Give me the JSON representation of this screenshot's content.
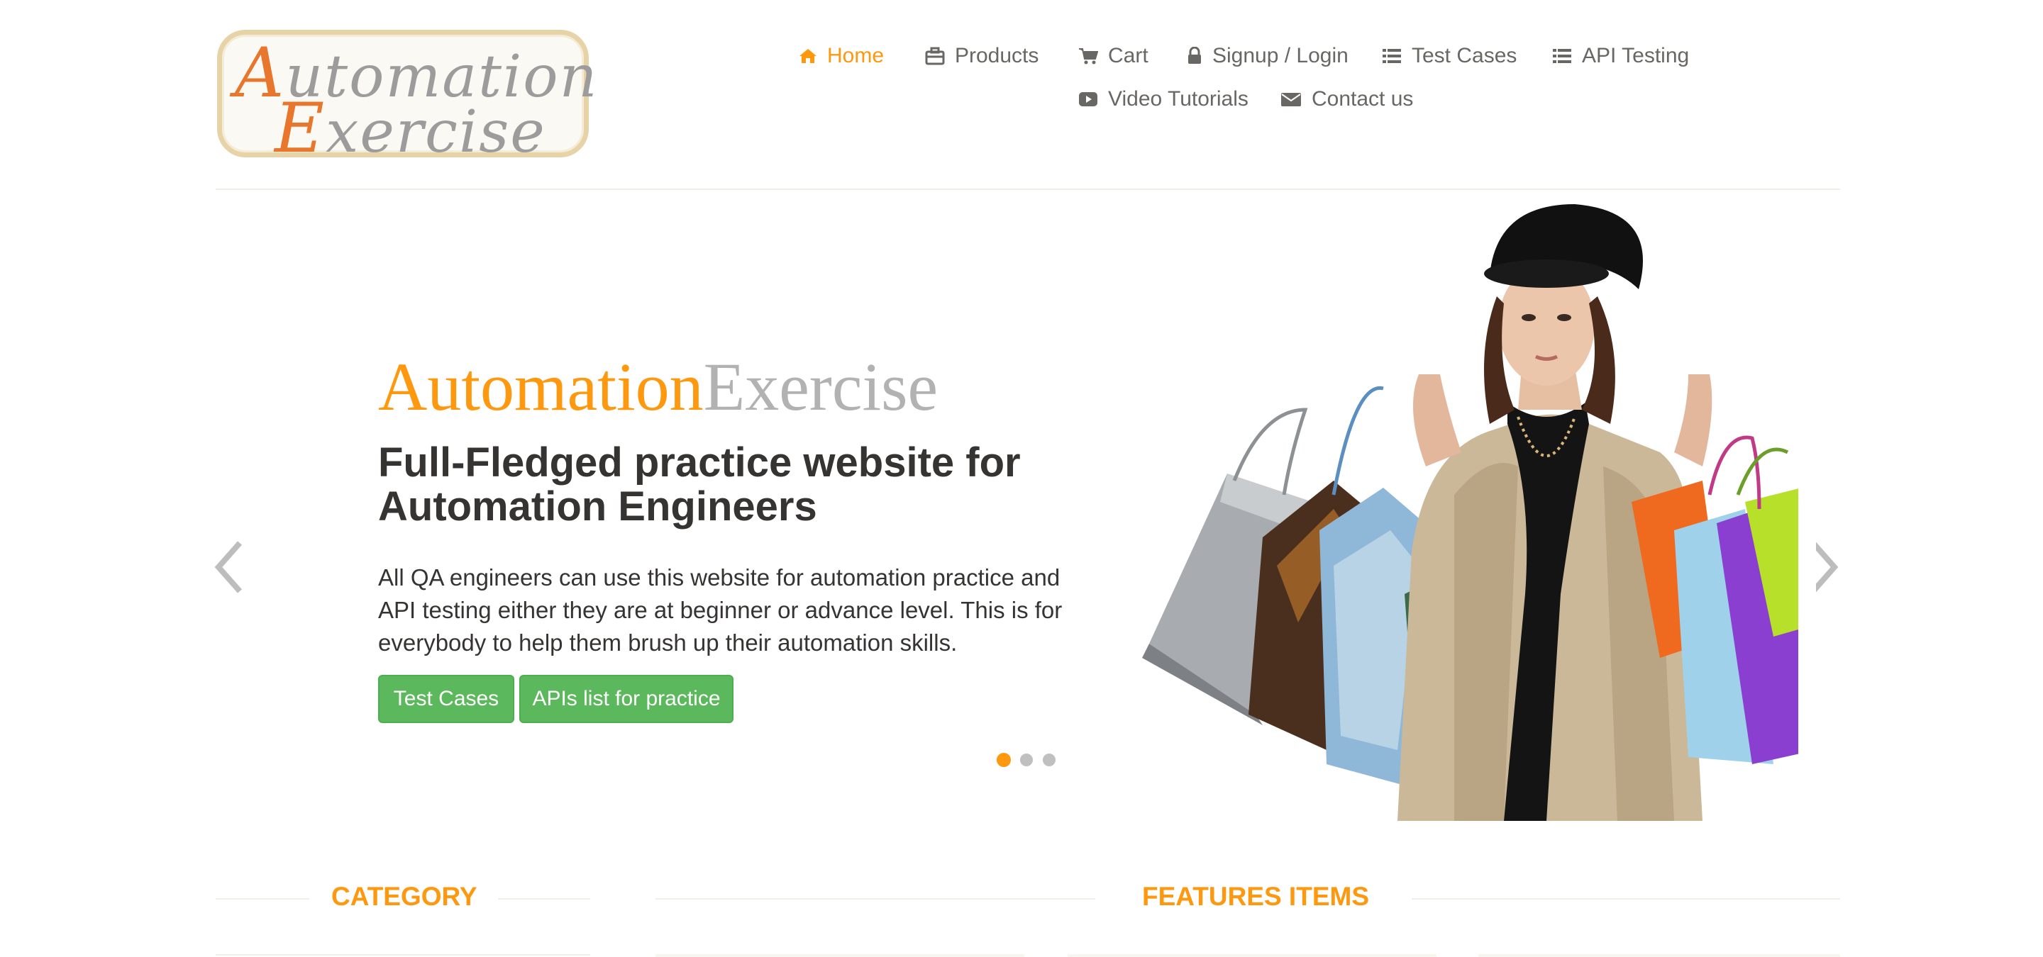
{
  "logo": {
    "line1_cap": "A",
    "line1_rest": "utomation",
    "line2_cap": "E",
    "line2_rest": "xercise"
  },
  "nav": {
    "items": [
      {
        "label": "Home",
        "icon": "home-icon",
        "active": true
      },
      {
        "label": "Products",
        "icon": "briefcase-icon"
      },
      {
        "label": "Cart",
        "icon": "cart-icon"
      },
      {
        "label": "Signup / Login",
        "icon": "lock-icon"
      },
      {
        "label": "Test Cases",
        "icon": "list-icon"
      },
      {
        "label": "API Testing",
        "icon": "list-icon"
      },
      {
        "label": "Video Tutorials",
        "icon": "youtube-icon"
      },
      {
        "label": "Contact us",
        "icon": "envelope-icon"
      }
    ]
  },
  "slider": {
    "brand_part1": "Automation",
    "brand_part2": "Exercise",
    "headline": "Full-Fledged practice website for Automation Engineers",
    "description": "All QA engineers can use this website for automation practice and API testing either they are at beginner or advance level. This is for everybody to help them brush up their automation skills.",
    "buttons": {
      "test_cases": "Test Cases",
      "apis_list": "APIs list for practice"
    },
    "indicators": {
      "count": 3,
      "active_index": 0
    }
  },
  "sections": {
    "category_title": "CATEGORY",
    "features_title": "FEATURES ITEMS"
  },
  "colors": {
    "accent": "#fe980f",
    "button": "#5cb85c",
    "text": "#696763",
    "heading": "#363432"
  }
}
